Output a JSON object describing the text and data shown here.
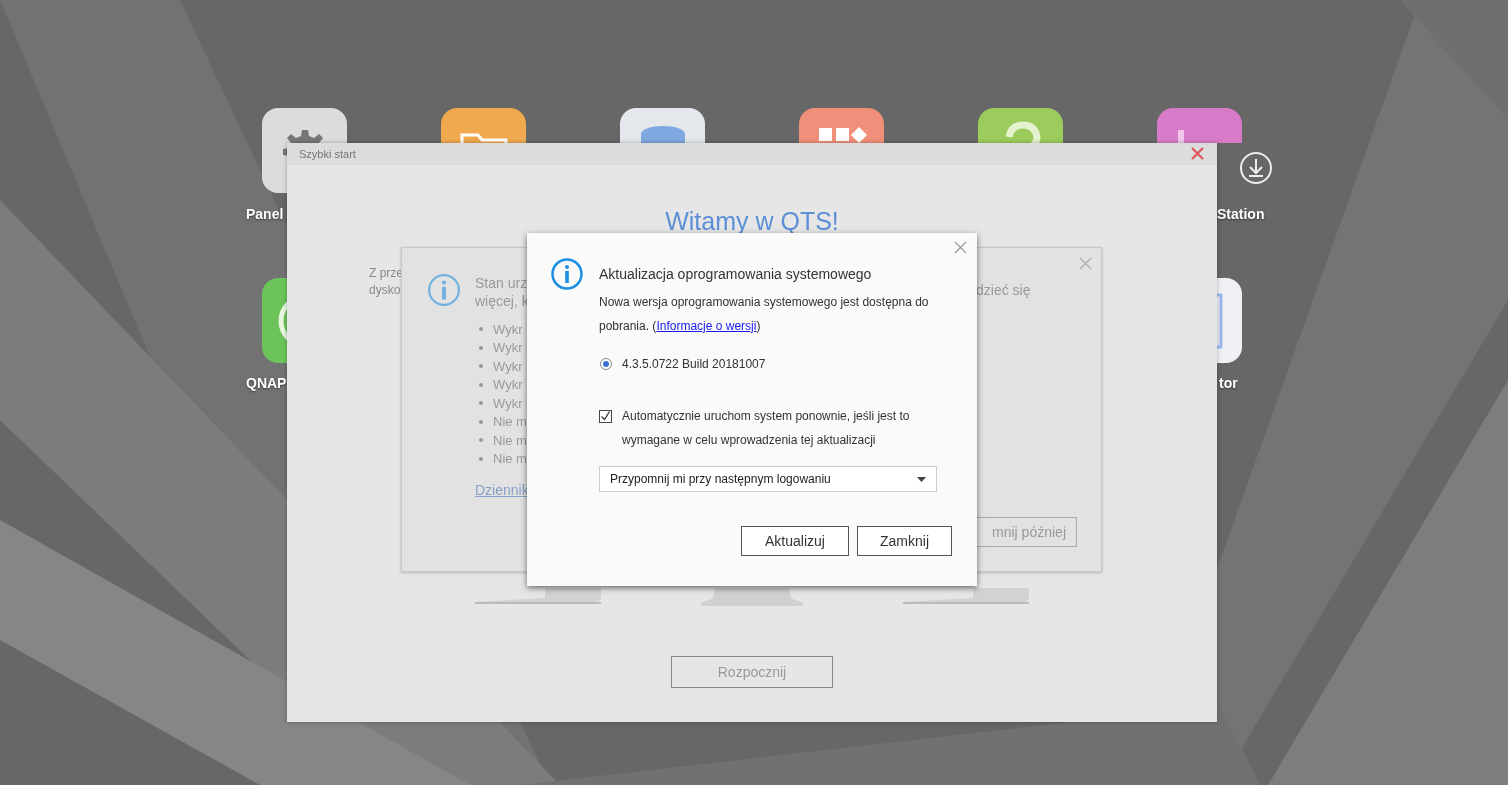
{
  "desktop_icons": [
    {
      "kind": "gear",
      "color": "#dcdcdc",
      "label": "Panel"
    },
    {
      "kind": "folder",
      "color": "#f0a94e"
    },
    {
      "kind": "database",
      "color": "#e4e8ec"
    },
    {
      "kind": "apps",
      "color": "#f08f7a"
    },
    {
      "kind": "help",
      "color": "#9ccc5c"
    },
    {
      "kind": "station",
      "color": "#d77bc8",
      "label": "Station"
    },
    {
      "kind": "ring",
      "color": "#6cc35a",
      "label": "QNAP"
    },
    {
      "kind": "monitor",
      "color": "#eef0f4",
      "label": "tor"
    }
  ],
  "quick_start": {
    "title": "Szybki start",
    "heading": "Witamy w QTS!",
    "intro": [
      "Z prze",
      "dysko"
    ],
    "start_button": "Rozpocznij"
  },
  "notice_dialog": {
    "intro": [
      "Stan urz",
      "więcej, k"
    ],
    "bullets": [
      "Wykr",
      "Wykr",
      "Wykr",
      "Wykr",
      "Wykr",
      "Nie m",
      "Nie m",
      "Nie m"
    ],
    "link": "Dziennik",
    "right_text": "dzieć się",
    "remind_button": "mnij później"
  },
  "update_dialog": {
    "title": "Aktualizacja oprogramowania systemowego",
    "message": "Nowa wersja oprogramowania systemowego jest dostępna do pobrania. (",
    "link": "Informacje o wersji",
    "message_end": ")",
    "versions": [
      {
        "label": "4.3.5.0722 Build 20181007",
        "selected": true
      }
    ],
    "auto_restart": {
      "label": "Automatycznie uruchom system ponownie, jeśli jest to wymagane w celu wprowadzenia tej aktualizacji",
      "checked": true
    },
    "reminder": {
      "value": "Przypomnij mi przy następnym logowaniu"
    },
    "buttons": [
      "Aktualizuj",
      "Zamknij"
    ]
  }
}
